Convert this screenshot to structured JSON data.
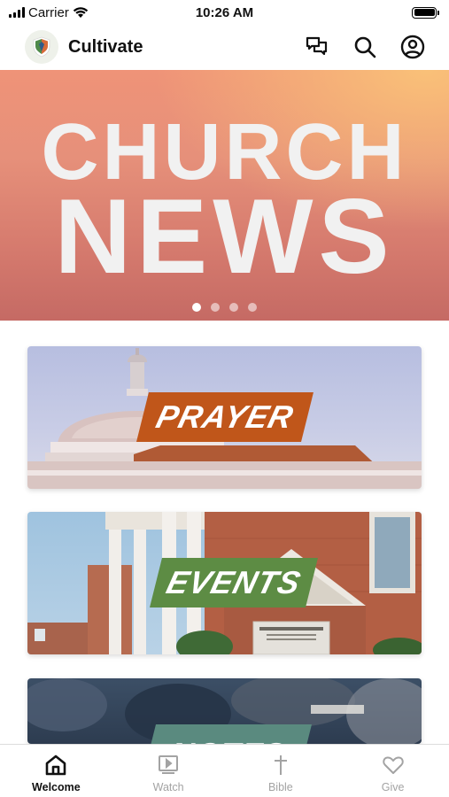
{
  "status_bar": {
    "carrier": "Carrier",
    "time": "10:26 AM"
  },
  "header": {
    "app_title": "Cultivate",
    "icons": [
      "chat-icon",
      "search-icon",
      "profile-icon"
    ]
  },
  "hero": {
    "line1": "CHURCH",
    "line2": "NEWS",
    "page_count": 4,
    "active_page": 1
  },
  "cards": [
    {
      "label": "PRAYER",
      "banner_color": "#c0561a"
    },
    {
      "label": "EVENTS",
      "banner_color": "#5d8c44"
    },
    {
      "label": "NOTES",
      "banner_color": "#5a8a7f"
    }
  ],
  "tab_bar": {
    "tabs": [
      {
        "label": "Welcome",
        "icon": "home-icon",
        "active": true
      },
      {
        "label": "Watch",
        "icon": "video-icon",
        "active": false
      },
      {
        "label": "Bible",
        "icon": "cross-icon",
        "active": false
      },
      {
        "label": "Give",
        "icon": "heart-icon",
        "active": false
      }
    ]
  },
  "colors": {
    "accent": "#111111",
    "inactive_tab": "#a3a3a3"
  }
}
